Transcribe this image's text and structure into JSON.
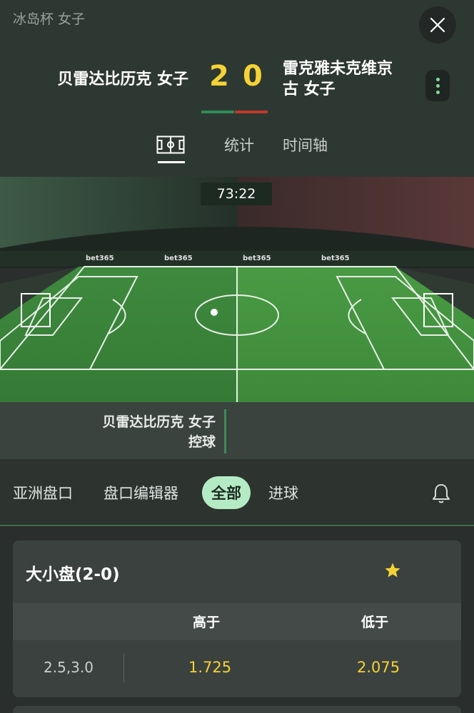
{
  "header": {
    "competition": "冰岛杯 女子",
    "home_team": "贝雷达比历克 女子",
    "away_team": "雷克雅未克维京古 女子",
    "home_score": "2",
    "away_score": "0",
    "home_color": "#2e8b57",
    "away_color": "#c0392b"
  },
  "tabs": {
    "pitch_icon": "pitch-icon",
    "stats": "统计",
    "timeline": "时间轴"
  },
  "match": {
    "clock": "73:22",
    "sponsor": "bet365",
    "possession_team": "贝雷达比历克 女子",
    "possession_label": "控球"
  },
  "markets": {
    "tabs": [
      "亚洲盘口",
      "盘口编辑器",
      "全部",
      "进球"
    ],
    "active_tab": "全部",
    "bell_icon": "bell-icon"
  },
  "card": {
    "title": "大小盘(2-0)",
    "star_color": "#f5d236",
    "col_over": "高于",
    "col_under": "低于",
    "line": "2.5,3.0",
    "odds_over": "1.725",
    "odds_under": "2.075"
  }
}
